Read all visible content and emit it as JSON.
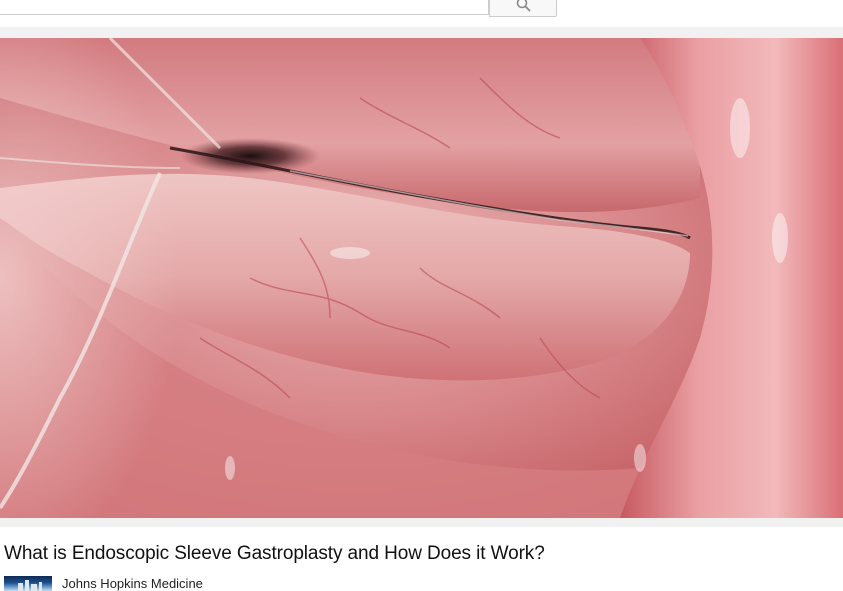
{
  "search": {
    "value": "",
    "placeholder": "",
    "button_icon": "search-icon"
  },
  "video": {
    "title": "What is Endoscopic Sleeve Gastroplasty and How Does it Work?",
    "channel": "Johns Hopkins Medicine",
    "thumbnail": "endoscopic view of stomach lining"
  },
  "colors": {
    "separator": "#f1f1f1",
    "title_text": "#111111",
    "tissue_base": "#c85a60"
  }
}
